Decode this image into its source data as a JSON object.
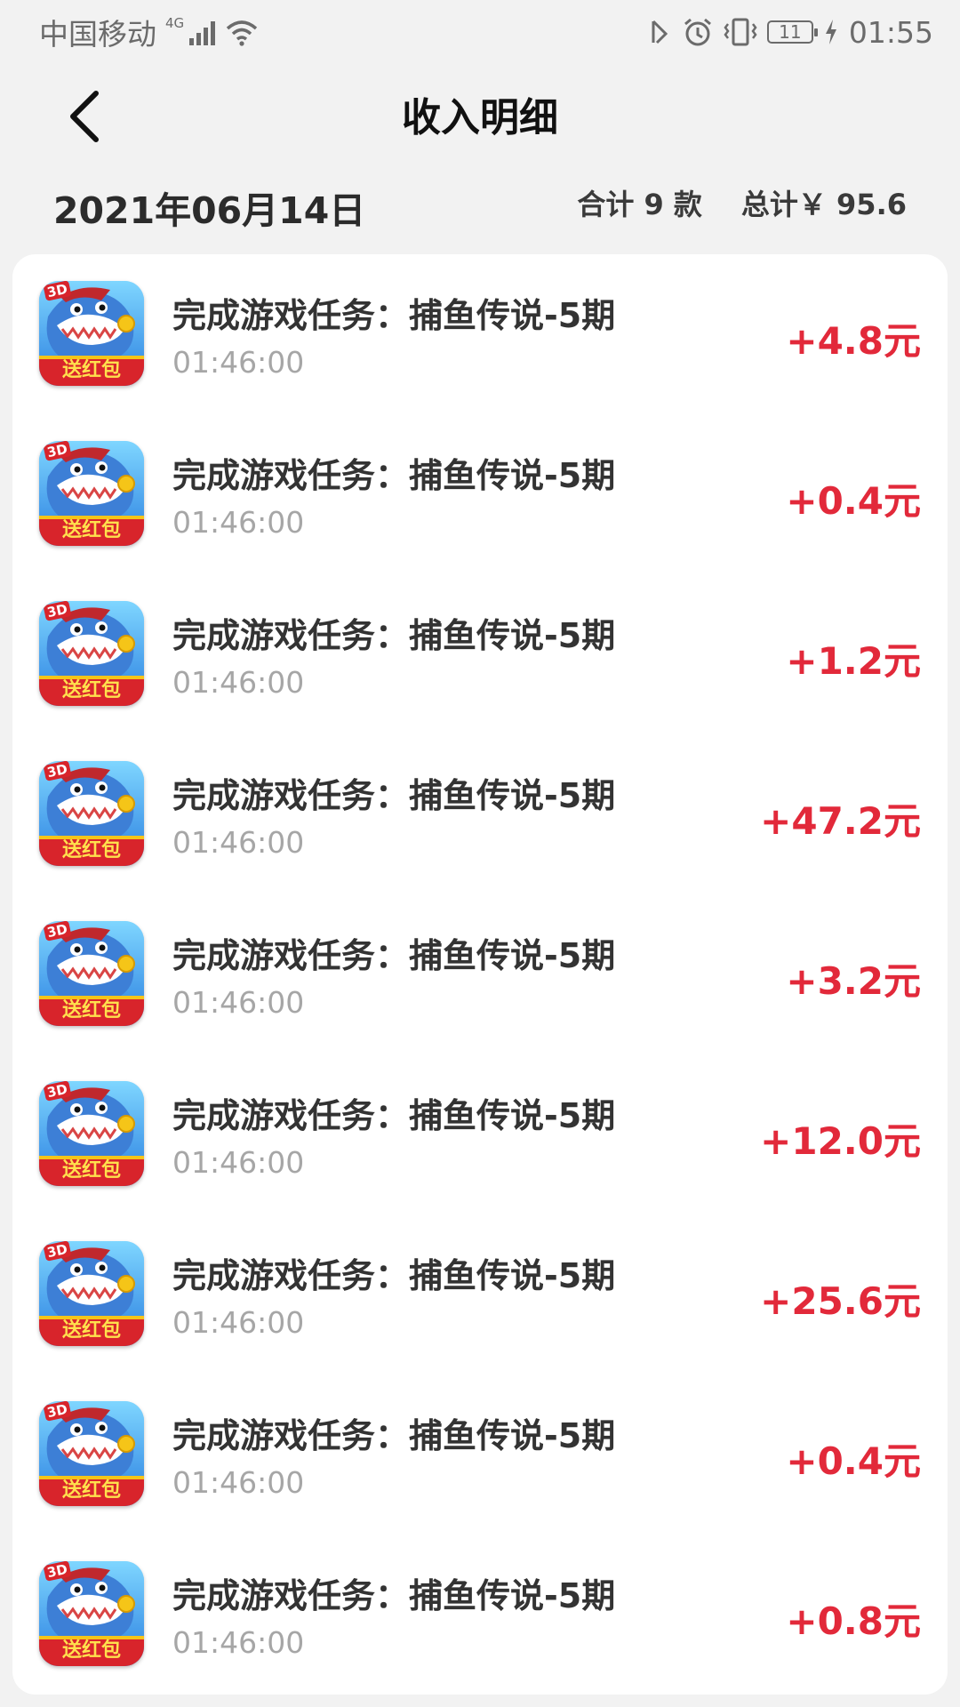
{
  "status_bar": {
    "carrier": "中国移动",
    "network": "4G",
    "battery": "11",
    "time": "01:55"
  },
  "header": {
    "title": "收入明细",
    "back_icon": "chevron-left-icon"
  },
  "summary": {
    "date": "2021年06月14日",
    "count_label": "合计 9 款",
    "total_label": "总计￥ 95.6"
  },
  "items": [
    {
      "title": "完成游戏任务：捕鱼传说-5期",
      "time": "01:46:00",
      "amount": "+4.8元"
    },
    {
      "title": "完成游戏任务：捕鱼传说-5期",
      "time": "01:46:00",
      "amount": "+0.4元"
    },
    {
      "title": "完成游戏任务：捕鱼传说-5期",
      "time": "01:46:00",
      "amount": "+1.2元"
    },
    {
      "title": "完成游戏任务：捕鱼传说-5期",
      "time": "01:46:00",
      "amount": "+47.2元"
    },
    {
      "title": "完成游戏任务：捕鱼传说-5期",
      "time": "01:46:00",
      "amount": "+3.2元"
    },
    {
      "title": "完成游戏任务：捕鱼传说-5期",
      "time": "01:46:00",
      "amount": "+12.0元"
    },
    {
      "title": "完成游戏任务：捕鱼传说-5期",
      "time": "01:46:00",
      "amount": "+25.6元"
    },
    {
      "title": "完成游戏任务：捕鱼传说-5期",
      "time": "01:46:00",
      "amount": "+0.4元"
    },
    {
      "title": "完成游戏任务：捕鱼传说-5期",
      "time": "01:46:00",
      "amount": "+0.8元"
    }
  ],
  "game_icon": {
    "badge": "3D",
    "banner": "送红包"
  },
  "colors": {
    "amount": "#e2293a",
    "background": "#f2f2f2",
    "card": "#ffffff"
  }
}
